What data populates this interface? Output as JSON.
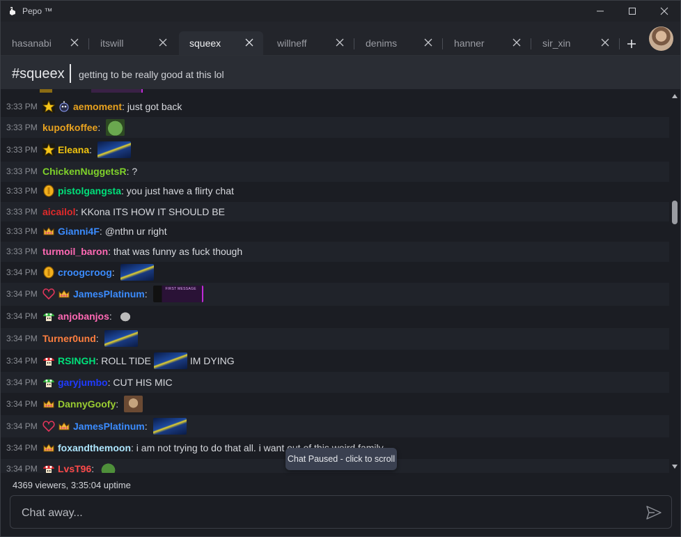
{
  "app": {
    "title": "Pepo ™"
  },
  "tabs": [
    {
      "label": "hasanabi"
    },
    {
      "label": "itswill"
    },
    {
      "label": "squeex",
      "active": true
    },
    {
      "label": "willneff"
    },
    {
      "label": "denims"
    },
    {
      "label": "hanner"
    },
    {
      "label": "sir_xin"
    }
  ],
  "channel": {
    "name": "#squeex",
    "title": "getting to be really good at this lol"
  },
  "messages": [
    {
      "time": "3:33 PM",
      "badges": [
        "star-badge",
        "bomb-badge"
      ],
      "user": "aemoment",
      "color": "#e8a21f",
      "text": "just got back"
    },
    {
      "time": "3:33 PM",
      "badges": [],
      "user": "kupofkoffee",
      "color": "#e8a21f",
      "text": "",
      "emotes": [
        "frog-emote"
      ]
    },
    {
      "time": "3:33 PM",
      "badges": [
        "star-badge"
      ],
      "user": "Eleana",
      "color": "#f1c40f",
      "text": "",
      "emotes": [
        "car-emote"
      ]
    },
    {
      "time": "3:33 PM",
      "badges": [],
      "user": "ChickenNuggetsR",
      "color": "#7fd22a",
      "text": "?"
    },
    {
      "time": "3:33 PM",
      "badges": [
        "coin-badge"
      ],
      "user": "pistolgangsta",
      "color": "#00e07a",
      "text": "you just have a flirty chat"
    },
    {
      "time": "3:33 PM",
      "badges": [],
      "user": "aicailol",
      "color": "#e02a2a",
      "text": "KKona ITS HOW IT SHOULD BE"
    },
    {
      "time": "3:33 PM",
      "badges": [
        "crown-badge"
      ],
      "user": "Gianni4F",
      "color": "#3b8cff",
      "text": "@nthn ur right"
    },
    {
      "time": "3:33 PM",
      "badges": [],
      "user": "turmoil_baron",
      "color": "#ff69b4",
      "text": "that was funny as fuck though"
    },
    {
      "time": "3:34 PM",
      "badges": [
        "coin-badge"
      ],
      "user": "croogcroog",
      "color": "#3b8cff",
      "text": "",
      "emotes": [
        "car-emote"
      ]
    },
    {
      "time": "3:34 PM",
      "badges": [
        "heart-badge",
        "crown-badge"
      ],
      "user": "JamesPlatinum",
      "color": "#3b8cff",
      "text": "",
      "emotes": [
        "first-message-emote"
      ],
      "first_label": "FIRST MESSAGE"
    },
    {
      "time": "3:34 PM",
      "badges": [
        "mushroom-green-badge"
      ],
      "user": "anjobanjos",
      "color": "#ff69b4",
      "text": "",
      "emotes": [
        "cat-emote"
      ]
    },
    {
      "time": "3:34 PM",
      "badges": [],
      "user": "Turner0und",
      "color": "#ff7f3f",
      "text": "",
      "emotes": [
        "car-emote"
      ]
    },
    {
      "time": "3:34 PM",
      "badges": [
        "mushroom-red-badge"
      ],
      "user": "RSINGH",
      "color": "#00e07a",
      "text": "ROLL TIDE",
      "emotes": [
        "car-emote"
      ],
      "text_after": "IM DYING"
    },
    {
      "time": "3:34 PM",
      "badges": [
        "mushroom-green-badge"
      ],
      "user": "garyjumbo",
      "color": "#1f3bff",
      "text": "CUT HIS MIC"
    },
    {
      "time": "3:34 PM",
      "badges": [
        "crown-badge"
      ],
      "user": "DannyGoofy",
      "color": "#9acd32",
      "text": "",
      "emotes": [
        "face-emote"
      ]
    },
    {
      "time": "3:34 PM",
      "badges": [
        "heart-badge",
        "crown-badge"
      ],
      "user": "JamesPlatinum",
      "color": "#3b8cff",
      "text": "",
      "emotes": [
        "car-emote"
      ]
    },
    {
      "time": "3:34 PM",
      "badges": [
        "crown-badge"
      ],
      "user": "foxandthemoon",
      "color": "#aee7ff",
      "text": "i am not trying to do that all. i want out of this weird family"
    },
    {
      "time": "3:34 PM",
      "badges": [
        "mushroom-red-badge"
      ],
      "user": "LvsT96",
      "color": "#ff4a4a",
      "text": "",
      "emotes": [
        "pepe-emote"
      ]
    }
  ],
  "pause_notice": "Chat Paused - click to scroll",
  "status": "4369 viewers, 3:35:04 uptime",
  "input": {
    "placeholder": "Chat away..."
  }
}
